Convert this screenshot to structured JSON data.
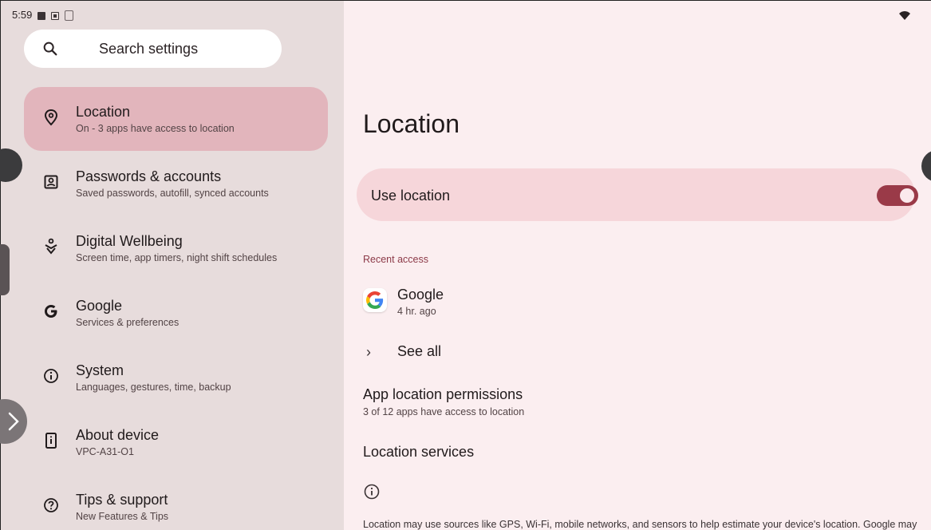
{
  "status_bar": {
    "time": "5:59"
  },
  "search": {
    "placeholder": "Search settings"
  },
  "nav": [
    {
      "title": "Location",
      "subtitle": "On - 3 apps have access to location",
      "icon": "location-pin-icon",
      "active": true
    },
    {
      "title": "Passwords & accounts",
      "subtitle": "Saved passwords, autofill, synced accounts",
      "icon": "account-box-icon"
    },
    {
      "title": "Digital Wellbeing",
      "subtitle": "Screen time, app timers, night shift schedules",
      "icon": "wellbeing-icon"
    },
    {
      "title": "Google",
      "subtitle": "Services & preferences",
      "icon": "google-g-icon"
    },
    {
      "title": "System",
      "subtitle": "Languages, gestures, time, backup",
      "icon": "info-circle-icon"
    },
    {
      "title": "About device",
      "subtitle": "VPC-A31-O1",
      "icon": "device-info-icon"
    },
    {
      "title": "Tips & support",
      "subtitle": "New Features & Tips",
      "icon": "help-circle-icon"
    }
  ],
  "detail": {
    "title": "Location",
    "use_location": {
      "label": "Use location",
      "enabled": true
    },
    "recent_access_header": "Recent access",
    "recent_apps": [
      {
        "name": "Google",
        "time": "4 hr. ago"
      }
    ],
    "see_all": "See all",
    "app_permissions": {
      "title": "App location permissions",
      "subtitle": "3 of 12 apps have access to location"
    },
    "location_services": "Location services",
    "footer": "Location may use sources like GPS, Wi-Fi, mobile networks, and sensors to help estimate your device's location. Google may"
  },
  "colors": {
    "accent": "#9a3a48",
    "active_nav": "#e2b5bc",
    "left_bg": "#e7dcdc",
    "right_bg": "#fbeef0",
    "toggle_card": "#f6d6da"
  }
}
